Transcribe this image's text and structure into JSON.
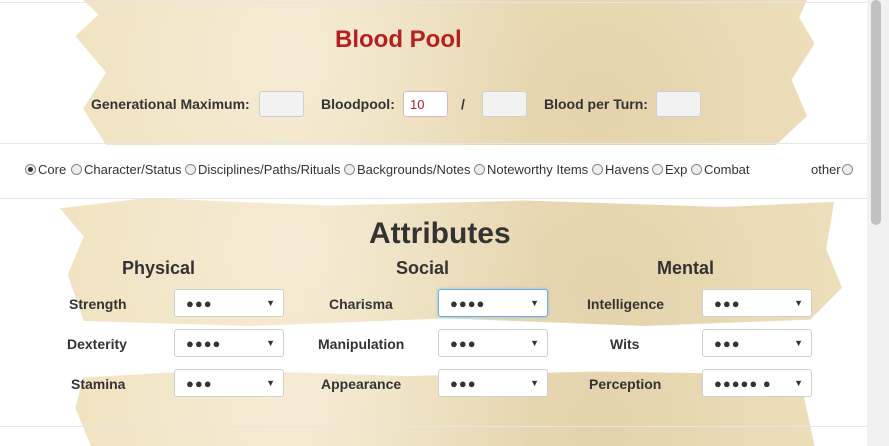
{
  "blood": {
    "title": "Blood Pool",
    "gen_max_label": "Generational Maximum:",
    "gen_max_value": "",
    "bloodpool_label": "Bloodpool:",
    "bloodpool_value": "10",
    "separator": "/",
    "bloodpool_max_value": "",
    "per_turn_label": "Blood per Turn:",
    "per_turn_value": ""
  },
  "tabs": {
    "selected": "Core",
    "items": [
      "Core",
      "Character/Status",
      "Disciplines/Paths/Rituals",
      "Backgrounds/Notes",
      "Noteworthy Items",
      "Havens",
      "Exp",
      "Combat"
    ],
    "other": "other"
  },
  "attributes": {
    "title": "Attributes",
    "physical": {
      "heading": "Physical",
      "rows": [
        {
          "label": "Strength",
          "value": "●●●"
        },
        {
          "label": "Dexterity",
          "value": "●●●●"
        },
        {
          "label": "Stamina",
          "value": "●●●"
        }
      ]
    },
    "social": {
      "heading": "Social",
      "rows": [
        {
          "label": "Charisma",
          "value": "●●●●"
        },
        {
          "label": "Manipulation",
          "value": "●●●"
        },
        {
          "label": "Appearance",
          "value": "●●●"
        }
      ]
    },
    "mental": {
      "heading": "Mental",
      "rows": [
        {
          "label": "Intelligence",
          "value": "●●●"
        },
        {
          "label": "Wits",
          "value": "●●●"
        },
        {
          "label": "Perception",
          "value": "●●●●● ●"
        }
      ]
    }
  },
  "icons": {
    "dropdown": "chevron-down-icon",
    "radio": "radio-icon"
  }
}
